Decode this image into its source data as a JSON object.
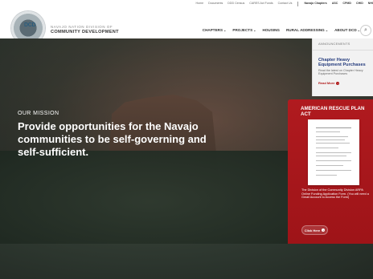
{
  "top_links": [
    "Home",
    "Documents",
    "DDD Census",
    "CARES Act Funds",
    "Contact Us",
    "Navajo Chapters",
    "ASC",
    "CPMD",
    "CHID",
    "NHI"
  ],
  "logo": {
    "text": "DCD"
  },
  "org": {
    "line1": "NAVAJO NATION DIVISION OF",
    "line2": "COMMUNITY DEVELOPMENT"
  },
  "nav": {
    "items": [
      {
        "label": "CHAPTERS",
        "has_dropdown": true
      },
      {
        "label": "PROJECTS",
        "has_dropdown": true
      },
      {
        "label": "HOUSING",
        "has_dropdown": false
      },
      {
        "label": "RURAL ADDRESSING",
        "has_dropdown": true
      },
      {
        "label": "ABOUT DCD",
        "has_dropdown": true
      }
    ],
    "chevron": "⌄",
    "search_icon": "search-icon",
    "search_glyph": "⌕"
  },
  "hero": {
    "kicker": "OUR MISSION",
    "text": "Provide opportunities for the Navajo communities to be self-governing and self-sufficient."
  },
  "announcements": {
    "title": "ANNOUNCEMENTS",
    "item_title": "Chapter Heavy Equipment Purchases",
    "item_desc": "Read the latest on Chapter Heavy Equipment Purchases",
    "read_more": "Read More",
    "read_more_arrow": "›"
  },
  "arp": {
    "title": "AMERICAN RESCUE PLAN ACT",
    "description": "The Division of the Community Division ARPA Online Funding Application Form. (You will need a Gmail Account to Access the Form)",
    "cta": "Click Here",
    "cta_arrow": "›"
  },
  "colors": {
    "brand_blue": "#243b7d",
    "accent_red": "#b01a1a",
    "arp_red": "#b01a1f"
  }
}
